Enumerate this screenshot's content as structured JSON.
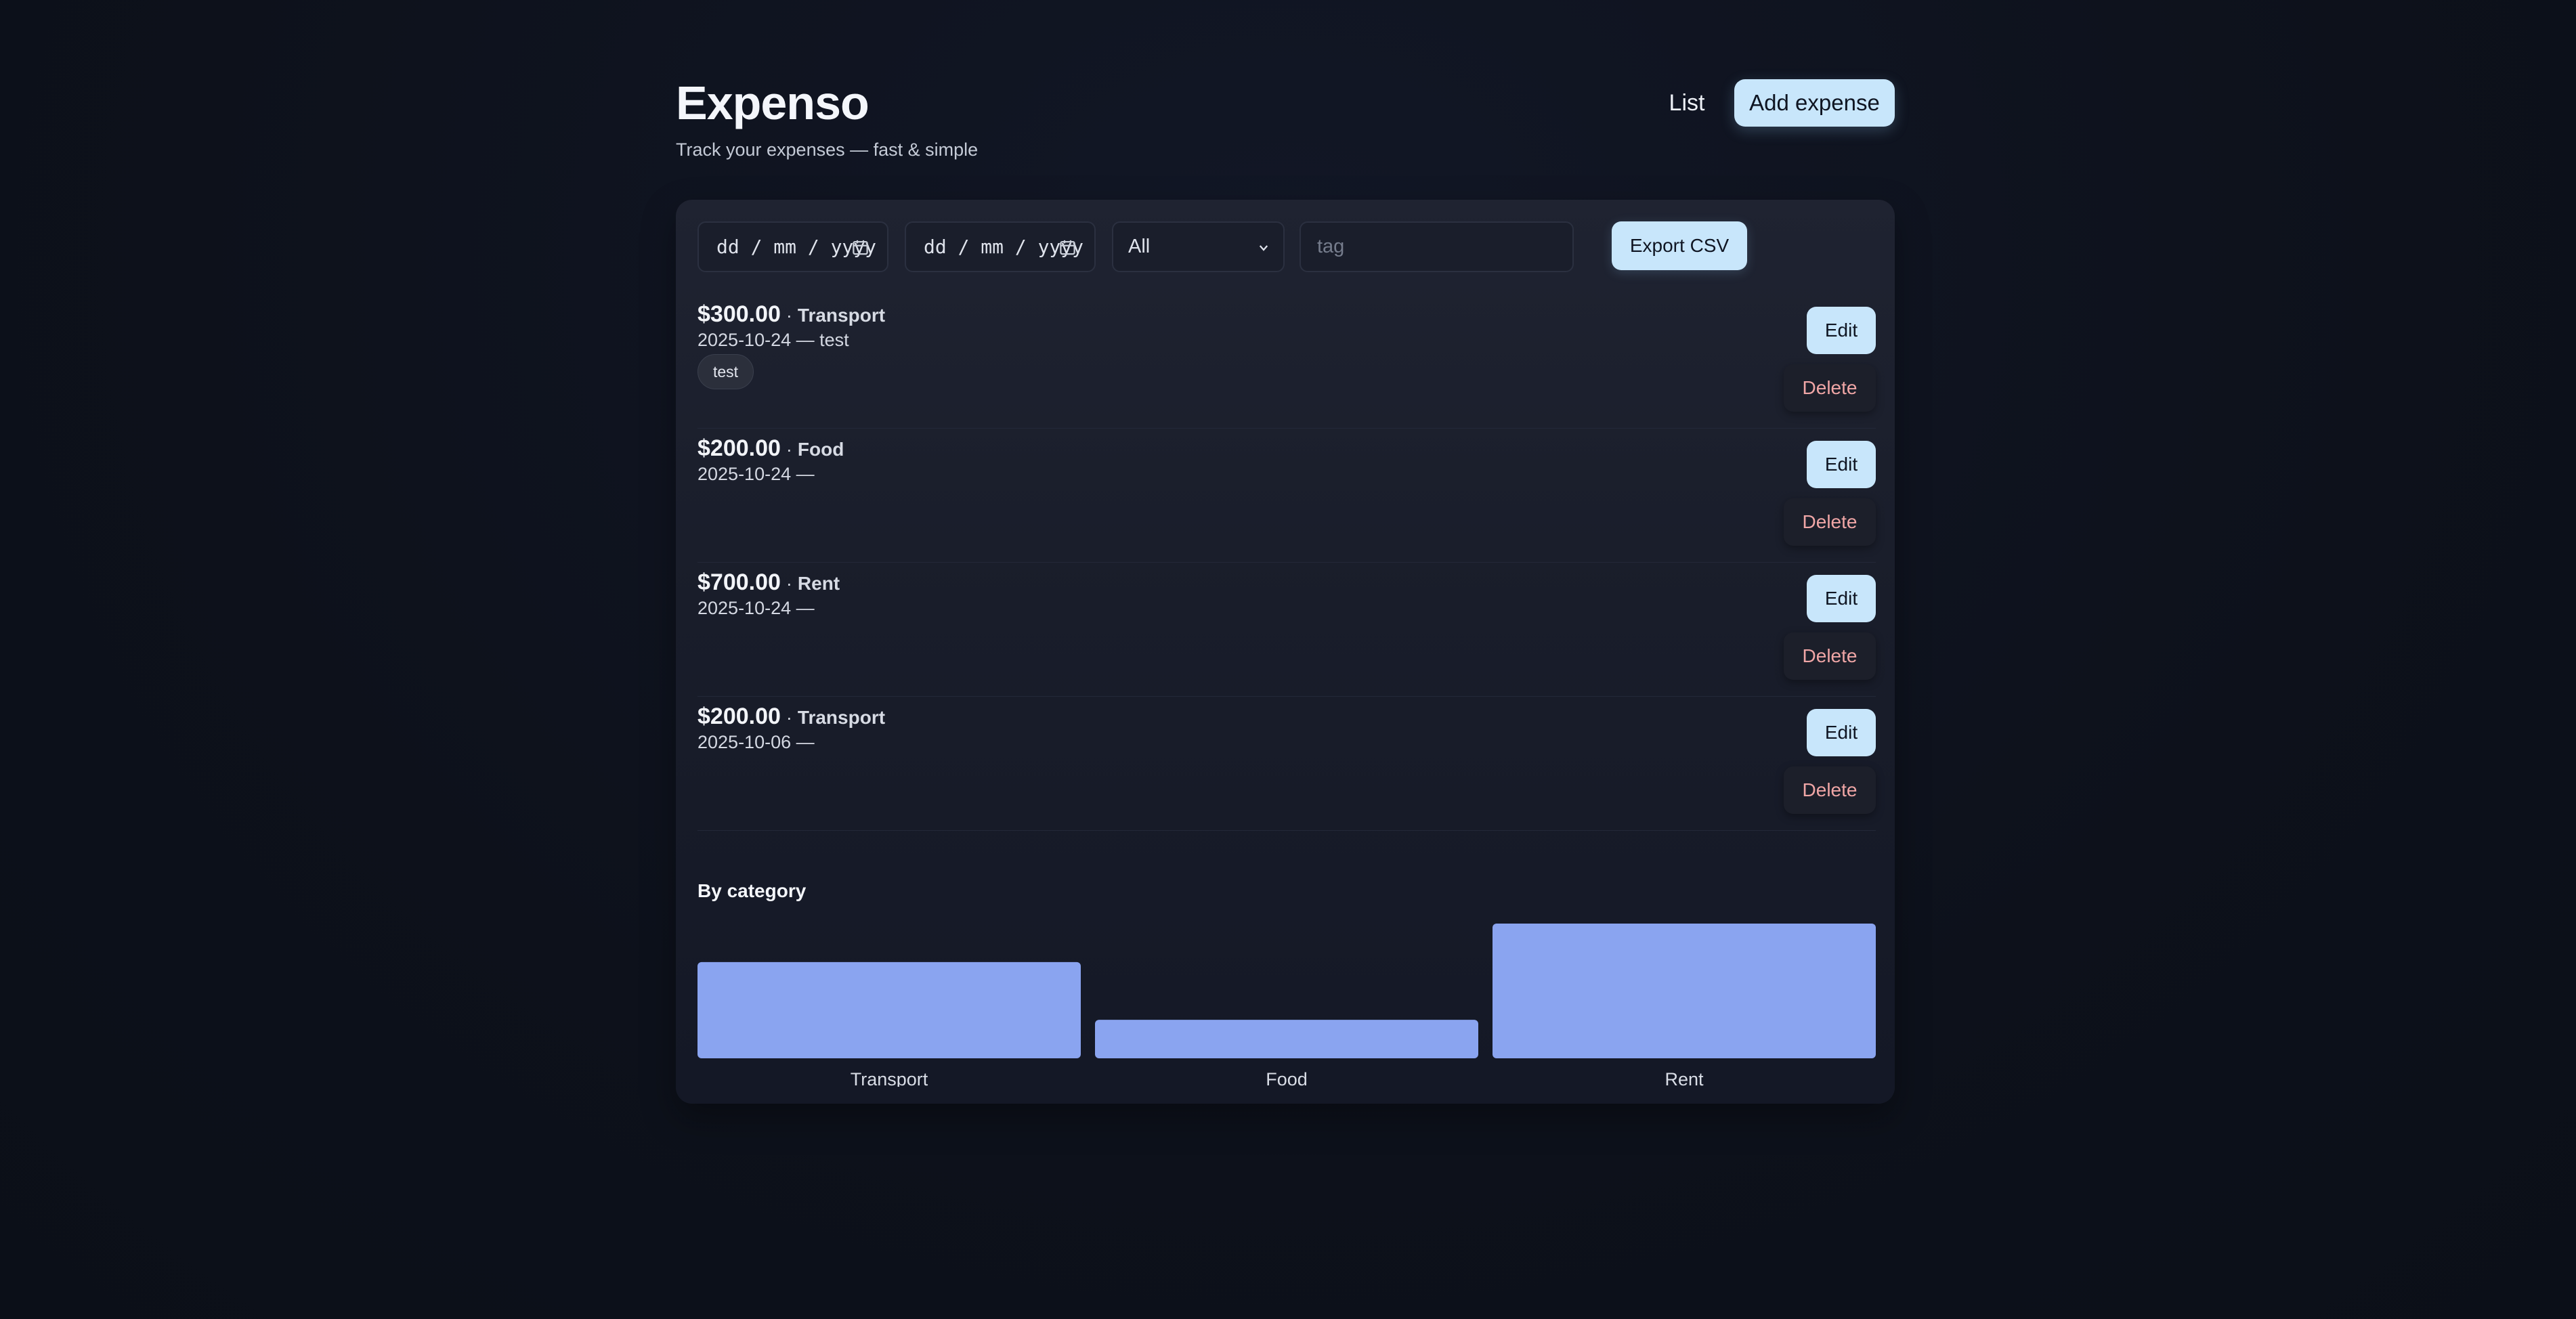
{
  "header": {
    "title": "Expenso",
    "subtitle": "Track your expenses — fast & simple",
    "nav_list": "List",
    "nav_add": "Add expense"
  },
  "filters": {
    "from_date": "dd / mm / yyyy",
    "to_date": "dd / mm / yyyy",
    "category_selected": "All",
    "tag_placeholder": "tag",
    "export_label": "Export CSV"
  },
  "expenses": [
    {
      "amount": "$300.00",
      "separator": "·",
      "category": "Transport",
      "meta": "2025-10-24 — test",
      "tag": "test",
      "edit": "Edit",
      "delete": "Delete"
    },
    {
      "amount": "$200.00",
      "separator": "·",
      "category": "Food",
      "meta": "2025-10-24 —",
      "edit": "Edit",
      "delete": "Delete"
    },
    {
      "amount": "$700.00",
      "separator": "·",
      "category": "Rent",
      "meta": "2025-10-24 —",
      "edit": "Edit",
      "delete": "Delete"
    },
    {
      "amount": "$200.00",
      "separator": "·",
      "category": "Transport",
      "meta": "2025-10-06 —",
      "edit": "Edit",
      "delete": "Delete"
    }
  ],
  "chart_title": "By category",
  "colors": {
    "accent": "#c8e6fb",
    "bar": "#8aa4f0",
    "danger_text": "#f0a6a6",
    "background": "#0e121c"
  },
  "icons": {
    "date": "calendar-icon",
    "select": "chevron-down-icon"
  },
  "chart_data": {
    "type": "bar",
    "title": "By category",
    "categories": [
      "Transport",
      "Food",
      "Rent"
    ],
    "values": [
      500,
      200,
      700
    ],
    "xlabel": "",
    "ylabel": "",
    "ylim": [
      0,
      700
    ],
    "grid": false
  }
}
